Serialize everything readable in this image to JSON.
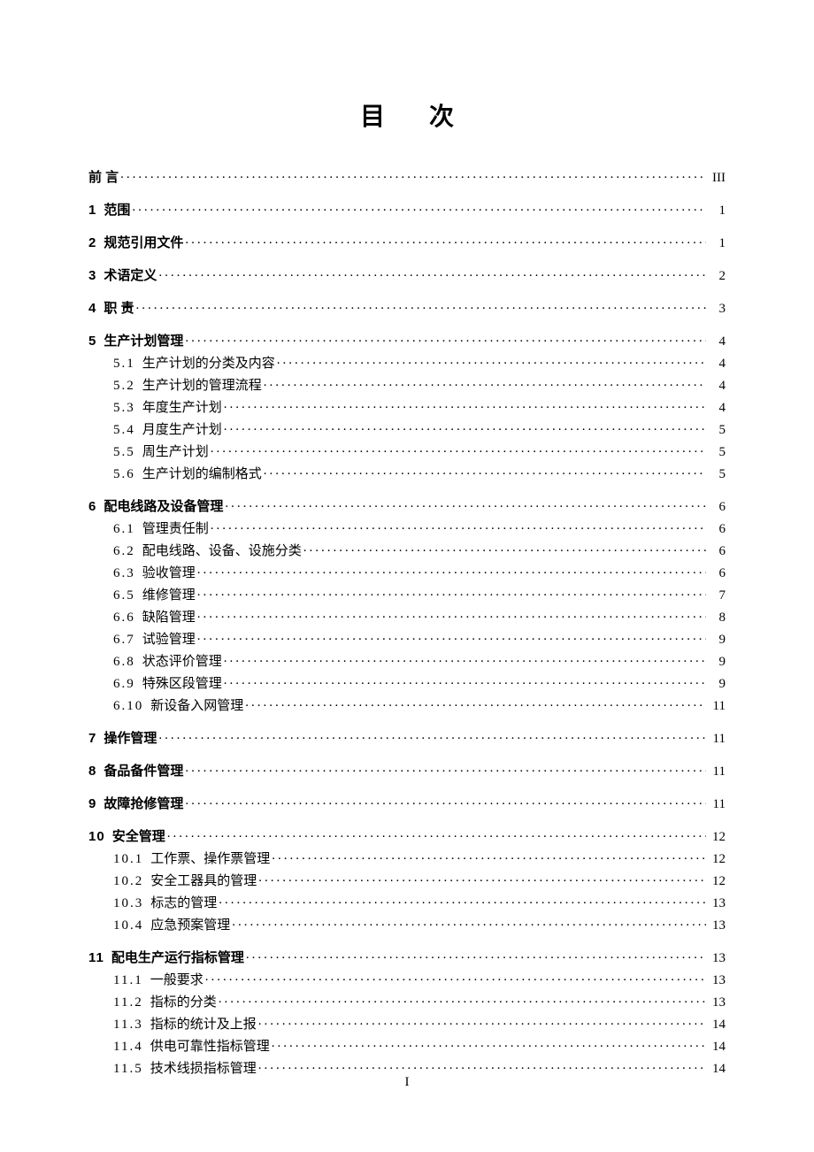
{
  "title": "目次",
  "page_footer": "I",
  "toc": [
    {
      "level": 1,
      "num": "",
      "label": "前    言",
      "page": "III"
    },
    {
      "level": 1,
      "num": "1",
      "label": "范围",
      "page": "1"
    },
    {
      "level": 1,
      "num": "2",
      "label": "规范引用文件",
      "page": "1"
    },
    {
      "level": 1,
      "num": "3",
      "label": "术语定义",
      "page": "2"
    },
    {
      "level": 1,
      "num": "4",
      "label": "职  责",
      "page": "3"
    },
    {
      "level": 1,
      "num": "5",
      "label": "生产计划管理",
      "page": "4"
    },
    {
      "level": 2,
      "num": "5.1",
      "label": "生产计划的分类及内容",
      "page": "4",
      "block_start": true
    },
    {
      "level": 2,
      "num": "5.2",
      "label": "生产计划的管理流程",
      "page": "4"
    },
    {
      "level": 2,
      "num": "5.3",
      "label": "年度生产计划",
      "page": "4"
    },
    {
      "level": 2,
      "num": "5.4",
      "label": "月度生产计划",
      "page": "5"
    },
    {
      "level": 2,
      "num": "5.5",
      "label": "周生产计划",
      "page": "5"
    },
    {
      "level": 2,
      "num": "5.6",
      "label": "生产计划的编制格式",
      "page": "5"
    },
    {
      "level": 1,
      "num": "6",
      "label": "配电线路及设备管理",
      "page": "6"
    },
    {
      "level": 2,
      "num": "6.1",
      "label": "管理责任制",
      "page": "6",
      "block_start": true
    },
    {
      "level": 2,
      "num": "6.2",
      "label": "配电线路、设备、设施分类",
      "page": "6"
    },
    {
      "level": 2,
      "num": "6.3",
      "label": "验收管理",
      "page": "6"
    },
    {
      "level": 2,
      "num": "6.5",
      "label": "维修管理",
      "page": "7"
    },
    {
      "level": 2,
      "num": "6.6",
      "label": "缺陷管理",
      "page": "8"
    },
    {
      "level": 2,
      "num": "6.7",
      "label": "试验管理",
      "page": "9"
    },
    {
      "level": 2,
      "num": "6.8",
      "label": "状态评价管理",
      "page": "9"
    },
    {
      "level": 2,
      "num": "6.9",
      "label": "特殊区段管理",
      "page": "9"
    },
    {
      "level": 2,
      "num": "6.10",
      "label": "新设备入网管理",
      "page": "11"
    },
    {
      "level": 1,
      "num": "7",
      "label": "操作管理",
      "page": "11"
    },
    {
      "level": 1,
      "num": "8",
      "label": "备品备件管理",
      "page": "11"
    },
    {
      "level": 1,
      "num": "9",
      "label": "故障抢修管理",
      "page": "11"
    },
    {
      "level": 1,
      "num": "10",
      "label": "安全管理",
      "page": "12"
    },
    {
      "level": 2,
      "num": "10.1",
      "label": "工作票、操作票管理",
      "page": "12",
      "block_start": true
    },
    {
      "level": 2,
      "num": "10.2",
      "label": "安全工器具的管理",
      "page": "12"
    },
    {
      "level": 2,
      "num": "10.3",
      "label": "标志的管理",
      "page": "13"
    },
    {
      "level": 2,
      "num": "10.4",
      "label": "应急预案管理",
      "page": "13"
    },
    {
      "level": 1,
      "num": "11",
      "label": "配电生产运行指标管理",
      "page": "13"
    },
    {
      "level": 2,
      "num": "11.1",
      "label": "一般要求",
      "page": "13",
      "block_start": true
    },
    {
      "level": 2,
      "num": "11.2",
      "label": "指标的分类",
      "page": "13"
    },
    {
      "level": 2,
      "num": "11.3",
      "label": "指标的统计及上报",
      "page": "14"
    },
    {
      "level": 2,
      "num": "11.4",
      "label": "供电可靠性指标管理",
      "page": "14"
    },
    {
      "level": 2,
      "num": "11.5",
      "label": "技术线损指标管理",
      "page": "14"
    }
  ]
}
